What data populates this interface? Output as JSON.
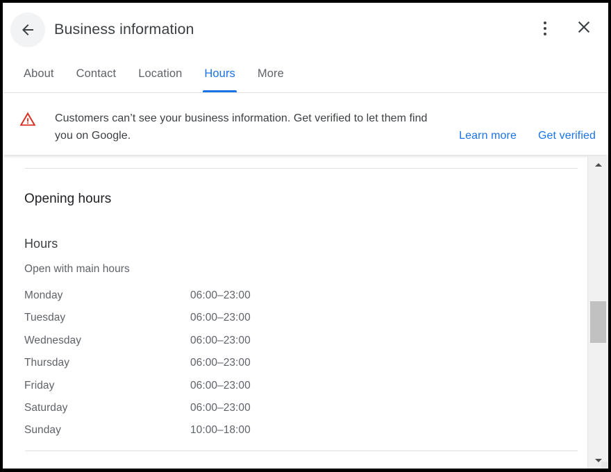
{
  "window": {
    "title": "Business information"
  },
  "header": {
    "back_icon": "arrow-left-icon",
    "title": "Business information",
    "menu_icon": "more-vert-icon",
    "close_icon": "close-icon"
  },
  "tabs": [
    {
      "label": "About",
      "active": false
    },
    {
      "label": "Contact",
      "active": false
    },
    {
      "label": "Location",
      "active": false
    },
    {
      "label": "Hours",
      "active": true
    },
    {
      "label": "More",
      "active": false
    }
  ],
  "banner": {
    "icon": "warning-triangle-icon",
    "icon_color": "#d93025",
    "message": "Customers can’t see your business information. Get verified to let them find you on Google.",
    "links": [
      {
        "label": "Learn more"
      },
      {
        "label": "Get verified"
      }
    ],
    "link_color": "#1a73e8"
  },
  "content": {
    "section_title": "Opening hours",
    "sub_title": "Hours",
    "sub_note": "Open with main hours",
    "hours": [
      {
        "day": "Monday",
        "time": "06:00–23:00"
      },
      {
        "day": "Tuesday",
        "time": "06:00–23:00"
      },
      {
        "day": "Wednesday",
        "time": "06:00–23:00"
      },
      {
        "day": "Thursday",
        "time": "06:00–23:00"
      },
      {
        "day": "Friday",
        "time": "06:00–23:00"
      },
      {
        "day": "Saturday",
        "time": "06:00–23:00"
      },
      {
        "day": "Sunday",
        "time": "10:00–18:00"
      }
    ]
  },
  "scrollbar": {
    "up_icon": "scroll-up-arrow-icon",
    "down_icon": "scroll-down-arrow-icon"
  },
  "colors": {
    "accent": "#1a73e8",
    "warning": "#d93025",
    "text_primary": "#202124",
    "text_secondary": "#5f6368"
  }
}
